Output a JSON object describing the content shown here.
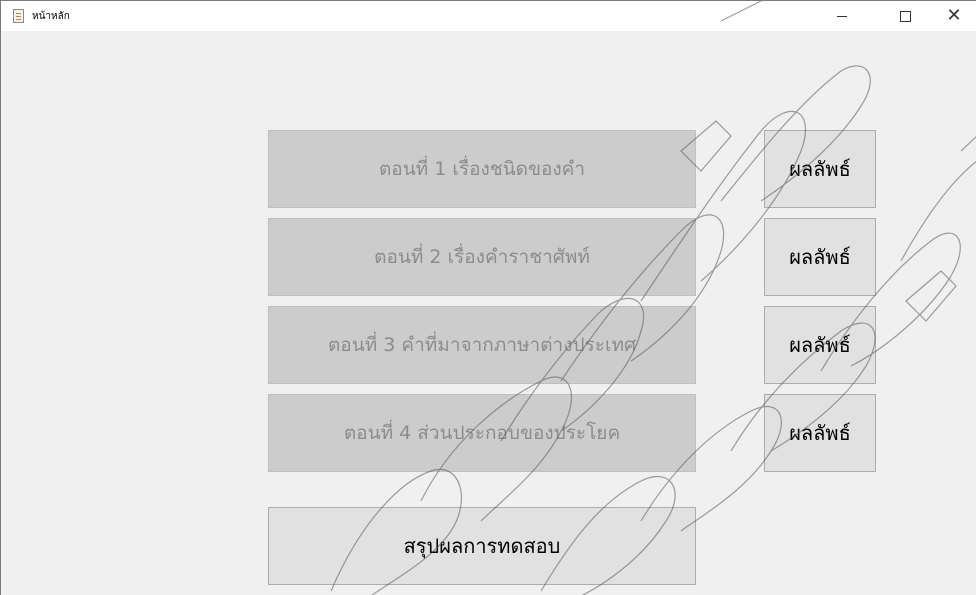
{
  "window": {
    "title": "หน้าหลัก",
    "controls": {
      "minimize": "—",
      "maximize": "☐",
      "close": "✕"
    }
  },
  "parts": [
    {
      "label": "ตอนที่ 1 เรื่องชนิดของคำ",
      "result_label": "ผลลัพธ์"
    },
    {
      "label": "ตอนที่ 2 เรื่องคำราชาศัพท์",
      "result_label": "ผลลัพธ์"
    },
    {
      "label": "ตอนที่ 3 คำที่มาจากภาษาต่างประเทศ",
      "result_label": "ผลลัพธ์"
    },
    {
      "label": "ตอนที่ 4 ส่วนประกอบของประโยค",
      "result_label": "ผลลัพธ์"
    }
  ],
  "summary_label": "สรุปผลการทดสอบ"
}
